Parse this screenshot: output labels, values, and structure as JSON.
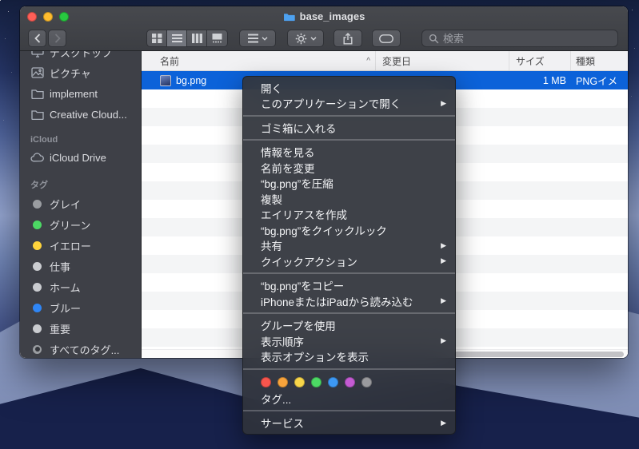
{
  "colors": {
    "selection": "#0c62d9"
  },
  "window": {
    "title": "base_images",
    "toolbar": {
      "search_placeholder": "検索"
    },
    "sidebar": {
      "favorites": [
        {
          "label": "デスクトップ"
        },
        {
          "label": "ピクチャ"
        },
        {
          "label": "implement"
        },
        {
          "label": "Creative Cloud..."
        }
      ],
      "sections": {
        "icloud": "iCloud",
        "tags": "タグ"
      },
      "icloud_items": [
        {
          "label": "iCloud Drive"
        }
      ],
      "tags": [
        {
          "label": "グレイ",
          "color": "#9a9da1"
        },
        {
          "label": "グリーン",
          "color": "#4cd964"
        },
        {
          "label": "イエロー",
          "color": "#ffd43c"
        },
        {
          "label": "仕事",
          "color": "#caccd0"
        },
        {
          "label": "ホーム",
          "color": "#caccd0"
        },
        {
          "label": "ブルー",
          "color": "#2f86f6"
        },
        {
          "label": "重要",
          "color": "#caccd0"
        },
        {
          "label": "すべてのタグ...",
          "color": "#9a9da1"
        }
      ]
    },
    "list": {
      "columns": {
        "name": "名前",
        "modified": "変更日",
        "size": "サイズ",
        "kind": "種類"
      },
      "sort_indicator": "^",
      "rows": [
        {
          "name": "bg.png",
          "size": "1 MB",
          "kind": "PNGイメ"
        }
      ]
    }
  },
  "context_menu": {
    "arrow": "▶",
    "items": {
      "open": "開く",
      "open_with": "このアプリケーションで開く",
      "move_to_trash": "ゴミ箱に入れる",
      "get_info": "情報を見る",
      "rename": "名前を変更",
      "compress": "“bg.png”を圧縮",
      "duplicate": "複製",
      "make_alias": "エイリアスを作成",
      "quick_look": "“bg.png”をクイックルック",
      "share": "共有",
      "quick_actions": "クイックアクション",
      "copy": "“bg.png”をコピー",
      "import_iphone": "iPhoneまたはiPadから読み込む",
      "use_groups": "グループを使用",
      "sort_by": "表示順序",
      "show_view_options": "表示オプションを表示",
      "tags": "タグ...",
      "services": "サービス"
    },
    "tag_colors": [
      "#f8554d",
      "#f7a43c",
      "#f8d64a",
      "#4cd964",
      "#3d99f5",
      "#c45bd3",
      "#9a9a9e"
    ]
  }
}
